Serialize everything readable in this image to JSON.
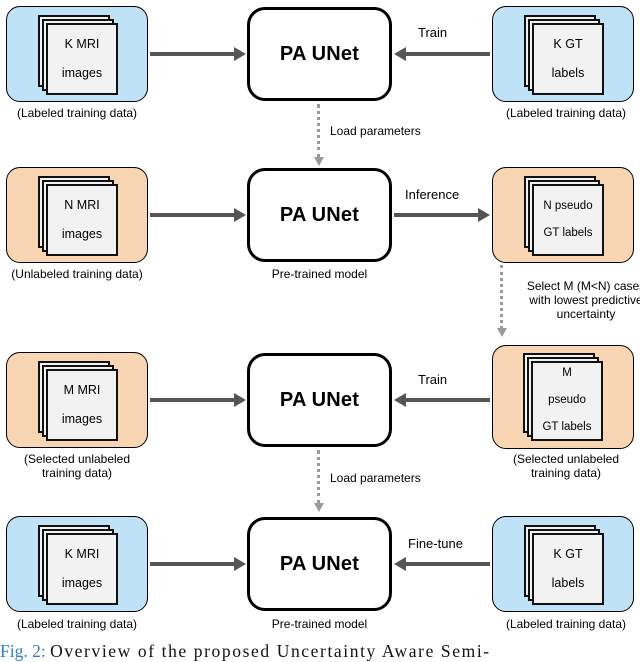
{
  "figure": {
    "caption_label": "Fig. 2:",
    "caption_text": "Overview of the proposed Uncertainty Aware Semi-"
  },
  "colors": {
    "labeled_box": "#bfe2f7",
    "unlabeled_box": "#f8d6b4",
    "arrow": "#555555",
    "dotted_arrow": "#9a9a9a",
    "sheet_fill": "#f2f2f2",
    "caption_link": "#2f7fd0"
  },
  "model_label": "PA UNet",
  "pretrained_label": "Pre-trained model",
  "rows": [
    {
      "id": "row1",
      "left": {
        "sheet_text": "K MRI\nimages",
        "sheet_line1": "K MRI",
        "sheet_line2": "images",
        "caption": "(Labeled training data)",
        "fill": "labeled"
      },
      "center": {
        "label": "PA UNet",
        "sublabel": ""
      },
      "right": {
        "sheet_line1": "K GT",
        "sheet_line2": "labels",
        "caption": "(Labeled training data)",
        "fill": "labeled"
      },
      "arrow_in_label": "",
      "arrow_out_label": "Train"
    },
    {
      "id": "row2",
      "left": {
        "sheet_line1": "N MRI",
        "sheet_line2": "images",
        "caption": "(Unlabeled training data)",
        "fill": "unlabeled"
      },
      "center": {
        "label": "PA UNet",
        "sublabel": "Pre-trained model"
      },
      "right": {
        "sheet_line1": "N pseudo",
        "sheet_line2": "GT labels",
        "caption": "",
        "fill": "unlabeled"
      },
      "arrow_in_label": "",
      "arrow_out_label": "Inference"
    },
    {
      "id": "row3",
      "left": {
        "sheet_line1": "M MRI",
        "sheet_line2": "images",
        "caption": "(Selected unlabeled\ntraining data)",
        "caption_line1": "(Selected unlabeled",
        "caption_line2": "training data)",
        "fill": "unlabeled"
      },
      "center": {
        "label": "PA UNet",
        "sublabel": ""
      },
      "right": {
        "sheet_line1": "M",
        "sheet_line2": "pseudo",
        "sheet_line3": "GT labels",
        "caption_line1": "(Selected unlabeled",
        "caption_line2": "training data)",
        "fill": "unlabeled"
      },
      "arrow_in_label": "",
      "arrow_out_label": "Train"
    },
    {
      "id": "row4",
      "left": {
        "sheet_line1": "K MRI",
        "sheet_line2": "images",
        "caption": "(Labeled training data)",
        "fill": "labeled"
      },
      "center": {
        "label": "PA UNet",
        "sublabel": "Pre-trained model"
      },
      "right": {
        "sheet_line1": "K GT",
        "sheet_line2": "labels",
        "caption": "(Labeled training data)",
        "fill": "labeled"
      },
      "arrow_in_label": "",
      "arrow_out_label": "Fine-tune"
    }
  ],
  "dotted_arrows": [
    {
      "id": "load-params-1",
      "label": "Load parameters"
    },
    {
      "id": "select-m",
      "label_line1": "Select M (M<N) cases",
      "label_line2": "with lowest predictive",
      "label_line3": "uncertainty"
    },
    {
      "id": "load-params-2",
      "label": "Load parameters"
    }
  ]
}
